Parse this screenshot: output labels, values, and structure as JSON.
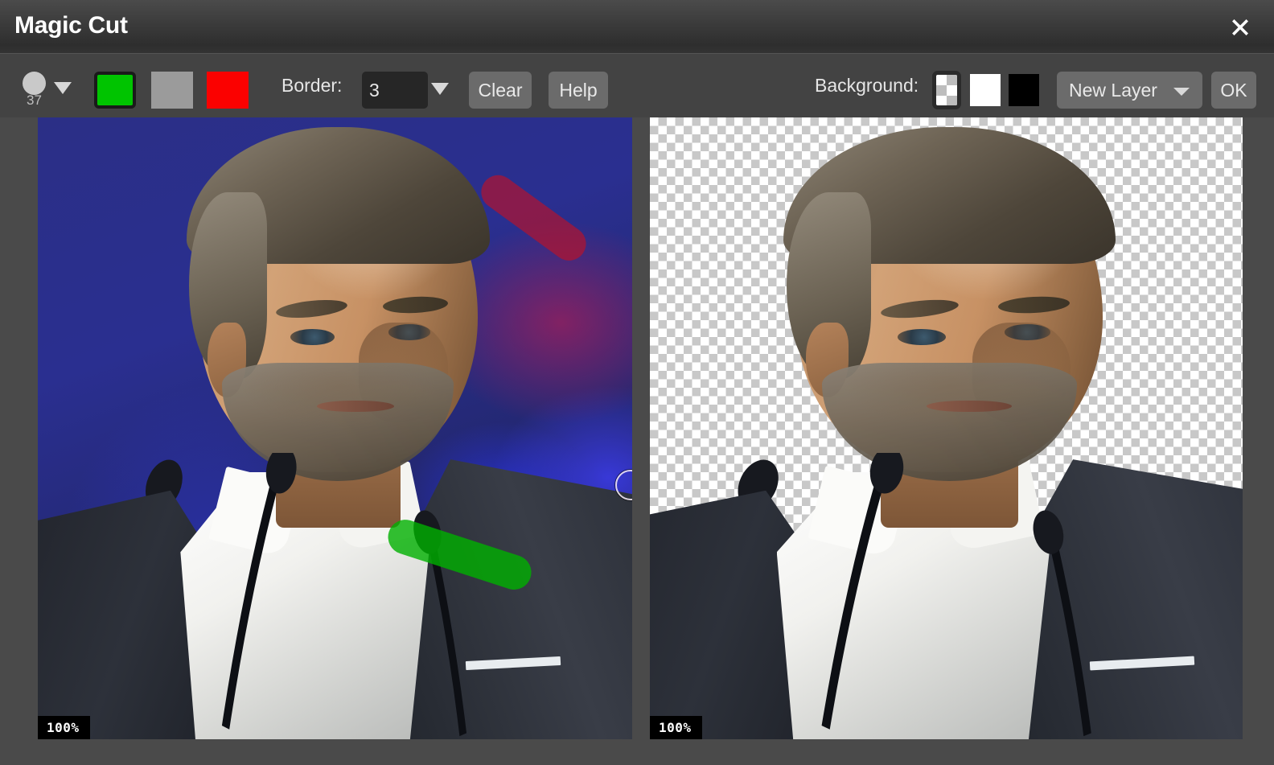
{
  "window": {
    "title": "Magic Cut",
    "close_icon": "close-icon"
  },
  "toolbar": {
    "brush": {
      "icon": "brush-size-circle-icon",
      "size_value": "37",
      "dropdown_icon": "triangle-down-icon"
    },
    "color_swatches": [
      {
        "name": "green",
        "hex": "#00c400",
        "selected": true,
        "role": "foreground-marker"
      },
      {
        "name": "gray",
        "hex": "#9b9b9b",
        "selected": false,
        "role": "unknown-marker"
      },
      {
        "name": "red",
        "hex": "#fb0100",
        "selected": false,
        "role": "background-marker"
      }
    ],
    "border": {
      "label": "Border:",
      "value": "3",
      "dropdown_icon": "triangle-down-icon"
    },
    "clear_label": "Clear",
    "help_label": "Help",
    "background": {
      "label": "Background:",
      "swatches": [
        {
          "name": "transparent",
          "selected": true
        },
        {
          "name": "white",
          "hex": "#ffffff",
          "selected": false
        },
        {
          "name": "black",
          "hex": "#000000",
          "selected": false
        }
      ]
    },
    "layer_select": {
      "value": "New Layer",
      "dropdown_icon": "triangle-down-icon"
    },
    "ok_label": "OK"
  },
  "panels": {
    "source": {
      "zoom_label": "100%",
      "strokes": [
        {
          "color": "red",
          "hex": "#c41022",
          "role": "background-marker"
        },
        {
          "color": "green",
          "hex": "#00b000",
          "role": "foreground-marker"
        }
      ],
      "cursor": "brush-circle-cursor"
    },
    "result": {
      "zoom_label": "100%",
      "background": "transparent-checkerboard"
    }
  }
}
